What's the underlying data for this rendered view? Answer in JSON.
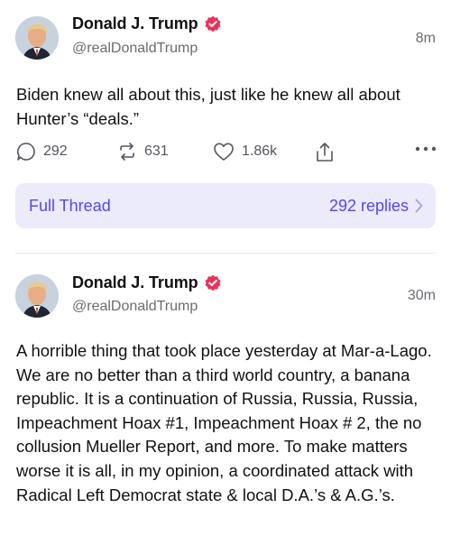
{
  "colors": {
    "accent": "#5448ee",
    "thread_bg": "#ebebfb",
    "verified": "#e8335a",
    "muted": "#6b6b73"
  },
  "posts": [
    {
      "author_name": "Donald J. Trump",
      "handle": "@realDonaldTrump",
      "time": "8m",
      "text": "Biden knew all about this, just like he knew all about Hunter’s “deals.”",
      "replies": "292",
      "retruths": "631",
      "likes": "1.86k",
      "icons": [
        "reply-icon",
        "retruth-icon",
        "like-icon",
        "share-icon",
        "more-icon"
      ],
      "thread": {
        "label": "Full Thread",
        "replies_label": "292 replies"
      }
    },
    {
      "author_name": "Donald J. Trump",
      "handle": "@realDonaldTrump",
      "time": "30m",
      "text": "A horrible thing that took place yesterday at Mar-a-Lago. We are no better than a third world country, a banana republic. It is a continuation of Russia, Russia, Russia, Impeachment Hoax #1, Impeachment Hoax # 2, the no collusion Mueller Report, and more. To make matters worse it is all, in my opinion, a coordinated attack with Radical Left Democrat state & local D.A.’s & A.G.’s."
    }
  ]
}
